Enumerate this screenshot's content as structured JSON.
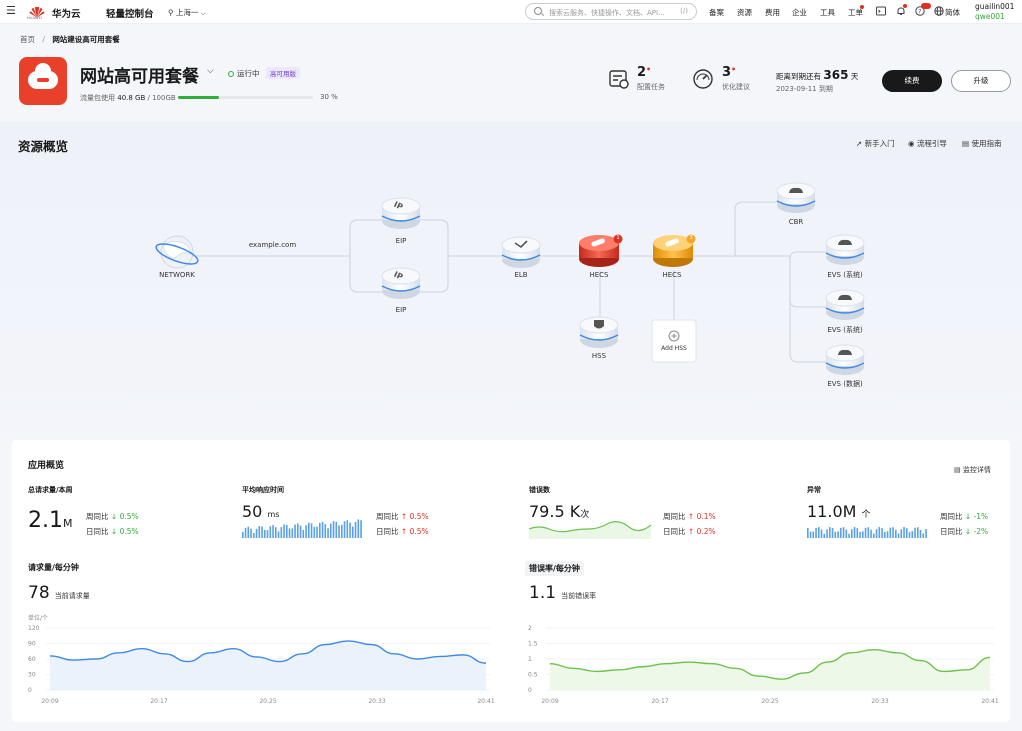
{
  "topbar": {
    "brand": "华为云",
    "logo_sub": "HUAWEI",
    "console": "轻量控制台",
    "region": "上海一",
    "search_placeholder": "搜索云服务、快捷操作、文档、API...",
    "search_shortcut": "(/)",
    "nav": [
      "备案",
      "资源",
      "费用",
      "企业",
      "工具",
      "工单"
    ],
    "language": "简体",
    "user_name": "guailin001",
    "user_account": "qwe001",
    "icons": [
      "menu-icon",
      "location-icon",
      "search-icon",
      "terminal-icon",
      "bell-icon",
      "help-icon",
      "globe-icon"
    ]
  },
  "breadcrumb": {
    "home": "首页",
    "current": "网站建设高可用套餐"
  },
  "header": {
    "title": "网站高可用套餐",
    "status": "运行中",
    "badge": "高可用版",
    "usage_label": "流量包使用",
    "usage_value": "40.8 GB",
    "usage_total": "/ 100GB",
    "usage_percent": "30 %",
    "usage_fraction": 0.3,
    "config_tasks": {
      "count": "2",
      "label": "配置任务"
    },
    "optimize": {
      "count": "3",
      "label": "优化建议"
    },
    "expire": {
      "prefix": "距离到期还有",
      "days": "365",
      "unit": "天",
      "date": "2023-09-11",
      "suffix": "到期"
    },
    "renew_label": "续费",
    "upgrade_label": "升级"
  },
  "topology": {
    "title": "资源概览",
    "links": [
      "新手入门",
      "流程引导",
      "使用指南"
    ],
    "nodes": {
      "network": "NETWORK",
      "domain": "example.com",
      "eip1": "EIP",
      "eip2": "EIP",
      "elb": "ELB",
      "hecs1": "HECS",
      "hecs1_badge": "1",
      "hecs2": "HECS",
      "hecs2_badge": "3",
      "hss": "HSS",
      "add_hss": "Add HSS",
      "cbr": "CBR",
      "evs1": "EVS (系统)",
      "evs2": "EVS (系统)",
      "evs3": "EVS (数据)"
    },
    "colors": {
      "hecs1": "#e8402a",
      "hecs2": "#f5a623"
    }
  },
  "app": {
    "title": "应用概览",
    "monitor_link": "监控详情",
    "metrics": [
      {
        "label": "总请求量/本周",
        "value": "2.1",
        "unit": "M",
        "wow_label": "周同比",
        "wow": "0.5%",
        "wow_dir": "down",
        "dod_label": "日同比",
        "dod": "0.5%",
        "dod_dir": "down"
      },
      {
        "label": "平均响应时间",
        "value": "50",
        "unit": "ms",
        "wow_label": "周同比",
        "wow": "0.5%",
        "wow_dir": "up",
        "dod_label": "日同比",
        "dod": "0.5%",
        "dod_dir": "up"
      },
      {
        "label": "错误数",
        "value": "79.5 K",
        "unit": "次",
        "wow_label": "周同比",
        "wow": "0.1%",
        "wow_dir": "up",
        "dod_label": "日同比",
        "dod": "0.2%",
        "dod_dir": "up"
      },
      {
        "label": "异常",
        "value": "11.0M",
        "unit": "个",
        "wow_label": "周同比",
        "wow": "-1%",
        "wow_dir": "down",
        "dod_label": "日同比",
        "dod": "-2%",
        "dod_dir": "down"
      }
    ],
    "req_chart": {
      "title": "请求量/每分钟",
      "current": "78",
      "current_label": "当前请求量",
      "unit_label": "单位/个"
    },
    "err_chart": {
      "title": "错误率/每分钟",
      "current": "1.1",
      "current_label": "当前错误率"
    }
  },
  "chart_data": [
    {
      "type": "area",
      "title": "请求量/每分钟",
      "x": [
        "20:09",
        "20:17",
        "20:25",
        "20:33",
        "20:41"
      ],
      "ylim": [
        0,
        120
      ],
      "yticks": [
        0,
        30,
        60,
        90,
        120
      ],
      "y": [
        66,
        58,
        60,
        72,
        80,
        70,
        55,
        72,
        80,
        64,
        55,
        70,
        88,
        95,
        88,
        70,
        60,
        65,
        68,
        52
      ]
    },
    {
      "type": "area",
      "title": "错误率/每分钟",
      "x": [
        "20:09",
        "20:17",
        "20:25",
        "20:33",
        "20:41"
      ],
      "ylim": [
        0,
        2
      ],
      "yticks": [
        0,
        0.5,
        1,
        1.5,
        2
      ],
      "y": [
        0.85,
        0.7,
        0.6,
        0.65,
        0.75,
        0.85,
        0.9,
        0.85,
        0.7,
        0.45,
        0.35,
        0.55,
        0.9,
        1.2,
        1.3,
        1.2,
        0.95,
        0.6,
        0.65,
        1.05
      ]
    }
  ]
}
